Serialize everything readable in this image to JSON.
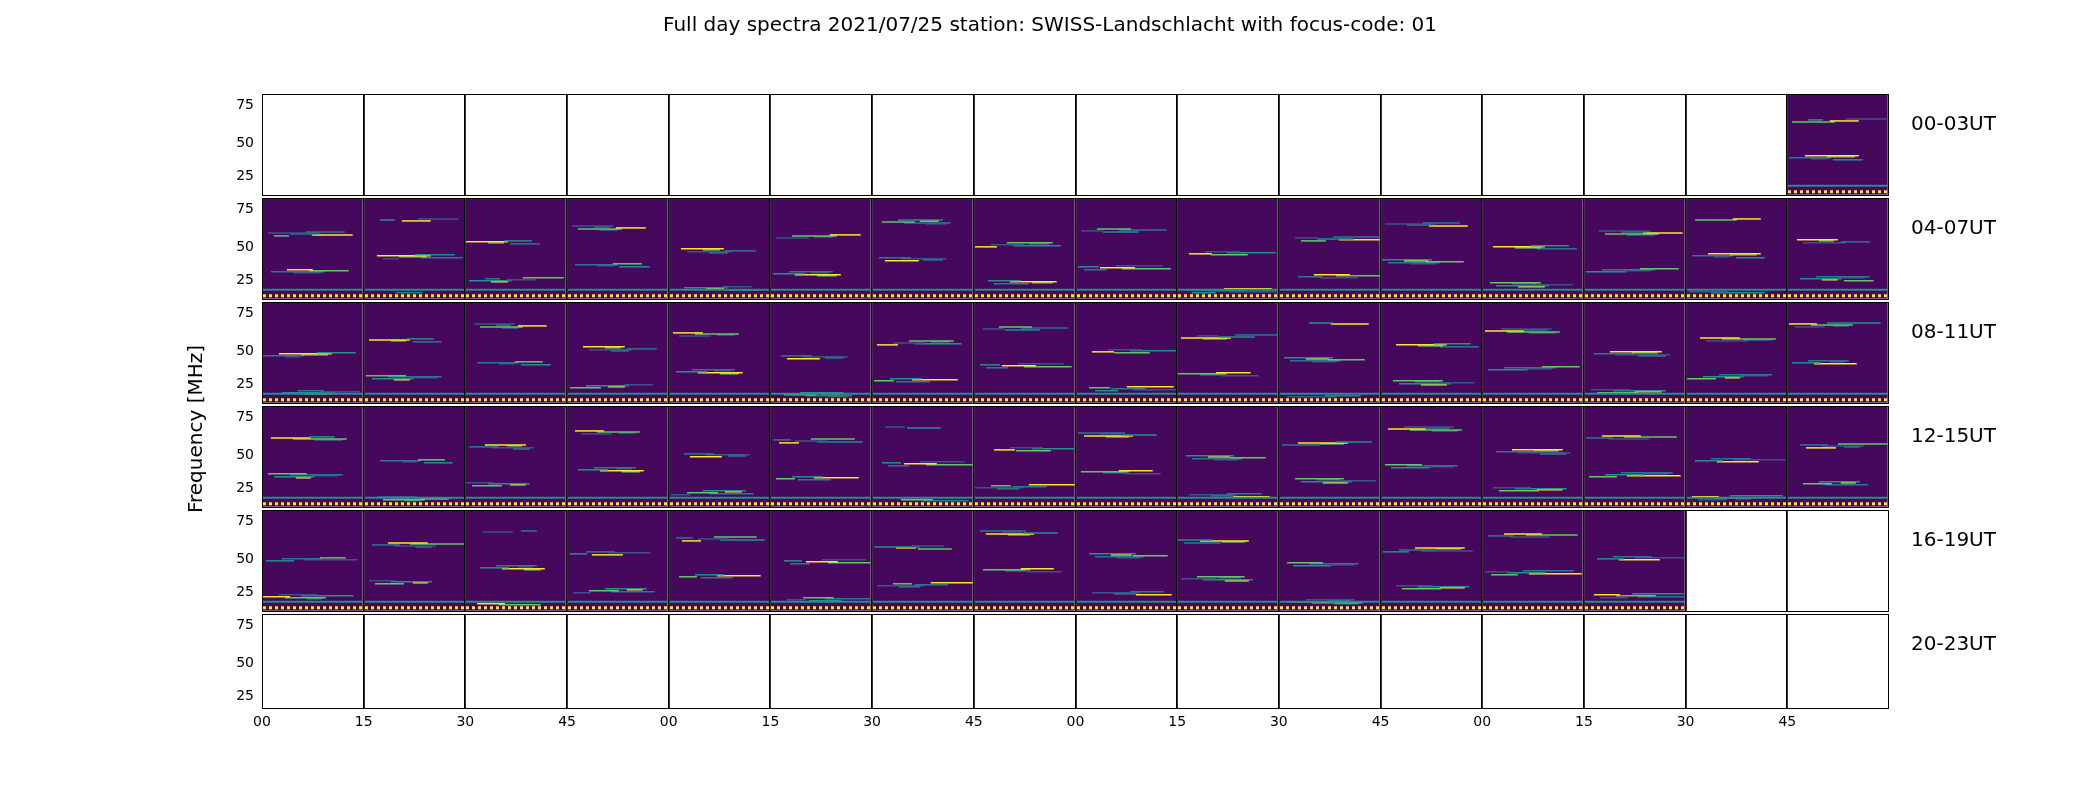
{
  "title": "Full day spectra 2021/07/25 station: SWISS-Landschlacht with focus-code: 01",
  "ylabel": "Frequency [MHz]",
  "xticks": [
    "00",
    "15",
    "30",
    "45",
    "00",
    "15",
    "30",
    "45",
    "00",
    "15",
    "30",
    "45",
    "00",
    "15",
    "30",
    "45"
  ],
  "rows": [
    {
      "label": "00-03UT",
      "yticks": [
        "75",
        "50",
        "25"
      ],
      "cells": [
        false,
        false,
        false,
        false,
        false,
        false,
        false,
        false,
        false,
        false,
        false,
        false,
        false,
        false,
        false,
        true
      ]
    },
    {
      "label": "04-07UT",
      "yticks": [
        "75",
        "50",
        "25"
      ],
      "cells": [
        true,
        true,
        true,
        true,
        true,
        true,
        true,
        true,
        true,
        true,
        true,
        true,
        true,
        true,
        true,
        true
      ]
    },
    {
      "label": "08-11UT",
      "yticks": [
        "75",
        "50",
        "25"
      ],
      "cells": [
        true,
        true,
        true,
        true,
        true,
        true,
        true,
        true,
        true,
        true,
        true,
        true,
        true,
        true,
        true,
        true
      ]
    },
    {
      "label": "12-15UT",
      "yticks": [
        "75",
        "50",
        "25"
      ],
      "cells": [
        true,
        true,
        true,
        true,
        true,
        true,
        true,
        true,
        true,
        true,
        true,
        true,
        true,
        true,
        true,
        true
      ]
    },
    {
      "label": "16-19UT",
      "yticks": [
        "75",
        "50",
        "25"
      ],
      "cells": [
        true,
        true,
        true,
        true,
        true,
        true,
        true,
        true,
        true,
        true,
        true,
        true,
        true,
        true,
        false,
        false
      ]
    },
    {
      "label": "20-23UT",
      "yticks": [
        "75",
        "50",
        "25"
      ],
      "cells": [
        false,
        false,
        false,
        false,
        false,
        false,
        false,
        false,
        false,
        false,
        false,
        false,
        false,
        false,
        false,
        false
      ]
    }
  ]
}
